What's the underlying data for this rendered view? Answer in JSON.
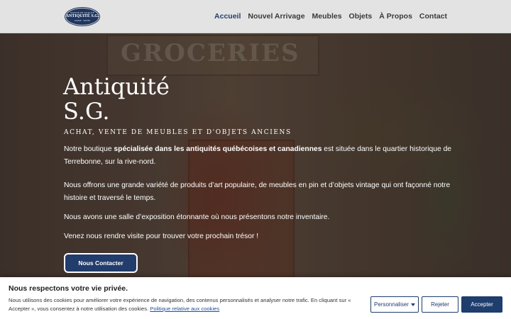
{
  "logo": {
    "top": "MAISON DE QUALITÉ",
    "main": "ANTIQUITÉ S.G.",
    "sub": "ACHAT · VENTE"
  },
  "nav": {
    "items": [
      {
        "label": "Accueil"
      },
      {
        "label": "Nouvel Arrivage"
      },
      {
        "label": "Meubles"
      },
      {
        "label": "Objets"
      },
      {
        "label": "À Propos"
      },
      {
        "label": "Contact"
      }
    ]
  },
  "hero": {
    "background_sign_text": "GROCERIES",
    "title": "Antiquité\nS.G.",
    "subtitle": "ACHAT, VENTE DE MEUBLES ET D'OBJETS ANCIENS",
    "p1_prefix": "Notre boutique ",
    "p1_bold": "spécialisée dans les antiquités québécoises et canadiennes",
    "p1_suffix": " est située dans le quartier historique de Terrebonne, sur la rive-nord.",
    "p2": "Nous offrons une grande variété de produits d’art populaire, de meubles en pin et d’objets vintage qui ont façonné notre histoire et traversé le temps.",
    "p3": "Nous avons une salle d’exposition étonnante où nous présentons notre inventaire.",
    "p4": "Venez nous rendre visite pour trouver votre prochain trésor !",
    "contact_button": "Nous Contacter"
  },
  "cookie_banner": {
    "title": "Nous respectons votre vie privée.",
    "text": "Nous utilisons des cookies pour améliorer votre expérience de navigation, des contenus personnalisés et analyser notre trafic. En cliquant sur « Accepter », vous consentez à notre utilisation des cookies. ",
    "link": "Politique relative aux cookies",
    "customize_button": "Personnaliser",
    "reject_button": "Rejeter",
    "accept_button": "Accepter"
  },
  "colors": {
    "brand_navy": "#1f3d6d",
    "header_bg": "#e3e3e3",
    "active_nav": "#233f6e"
  },
  "icons": {
    "customize_dropdown": "caret-down-icon"
  }
}
